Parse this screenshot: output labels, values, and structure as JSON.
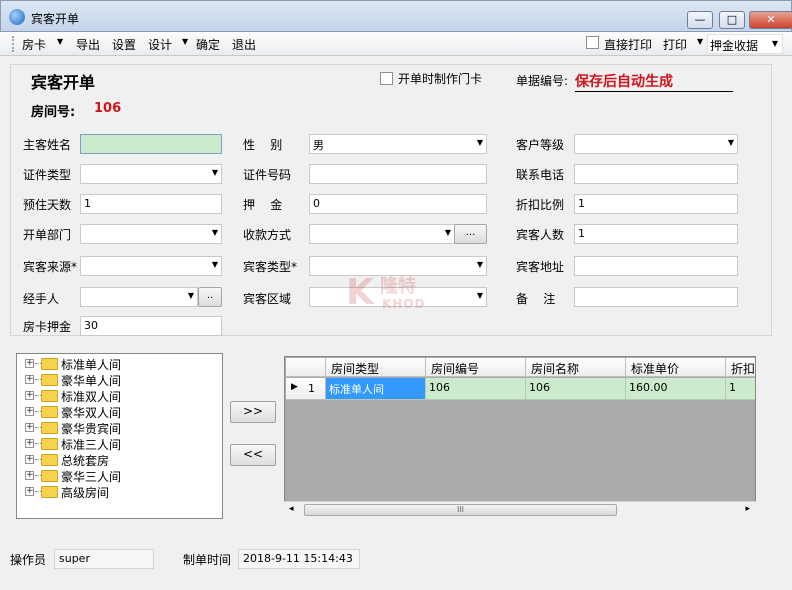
{
  "window": {
    "title": "宾客开单",
    "btn_min": "—",
    "btn_max": "□",
    "btn_close": "✕"
  },
  "toolbar": {
    "room_card": "房卡",
    "export": "导出",
    "settings": "设置",
    "design": "设计",
    "confirm": "确定",
    "exit": "退出",
    "direct_print": "直接打印",
    "print": "打印",
    "deposit_receipt": "押金收据",
    "arrow": "▼"
  },
  "form": {
    "title": "宾客开单",
    "room_no_label": "房间号:",
    "room_no": "106",
    "make_card_label": "开单时制作门卡",
    "doc_no_label": "单据编号:",
    "doc_no": "保存后自动生成",
    "fields": {
      "guest_name": {
        "label": "主客姓名",
        "value": ""
      },
      "gender": {
        "label": "性    别",
        "value": "男"
      },
      "customer_level": {
        "label": "客户等级",
        "value": ""
      },
      "id_type": {
        "label": "证件类型",
        "value": ""
      },
      "id_no": {
        "label": "证件号码",
        "value": ""
      },
      "phone": {
        "label": "联系电话",
        "value": ""
      },
      "days": {
        "label": "预住天数",
        "value": "1"
      },
      "deposit": {
        "label": "押    金",
        "value": "0"
      },
      "discount": {
        "label": "折扣比例",
        "value": "1"
      },
      "dept": {
        "label": "开单部门",
        "value": ""
      },
      "payment": {
        "label": "收款方式",
        "value": ""
      },
      "guest_count": {
        "label": "宾客人数",
        "value": "1"
      },
      "source": {
        "label": "宾客来源*",
        "value": ""
      },
      "guest_type": {
        "label": "宾客类型*",
        "value": ""
      },
      "address": {
        "label": "宾客地址",
        "value": ""
      },
      "handler": {
        "label": "经手人",
        "value": ""
      },
      "region": {
        "label": "宾客区域",
        "value": ""
      },
      "remarks": {
        "label": "备    注",
        "value": ""
      },
      "card_deposit": {
        "label": "房卡押金",
        "value": "30"
      }
    },
    "dots_label": "...",
    "dots_small": ".."
  },
  "tree": {
    "expand_glyph": "+",
    "items": [
      "标准单人间",
      "豪华单人间",
      "标准双人间",
      "豪华双人间",
      "豪华贵宾间",
      "标准三人间",
      "总统套房",
      "豪华三人间",
      "高级房间"
    ]
  },
  "move": {
    "add": ">>",
    "remove": "<<"
  },
  "grid": {
    "columns": [
      "房间类型",
      "房间编号",
      "房间名称",
      "标准单价",
      "折扣"
    ],
    "rows": [
      {
        "indicator": "▶",
        "num": "1",
        "cells": [
          "标准单人间",
          "106",
          "106",
          "160.00",
          "1"
        ]
      }
    ],
    "scroll_left": "◂",
    "scroll_right": "▸",
    "scroll_grip": "III"
  },
  "status": {
    "operator_label": "操作员",
    "operator": "super",
    "time_label": "制单时间",
    "time": "2018-9-11 15:14:43"
  },
  "watermark": {
    "letter": "K",
    "cn": "隆特",
    "en": "KHOD"
  }
}
